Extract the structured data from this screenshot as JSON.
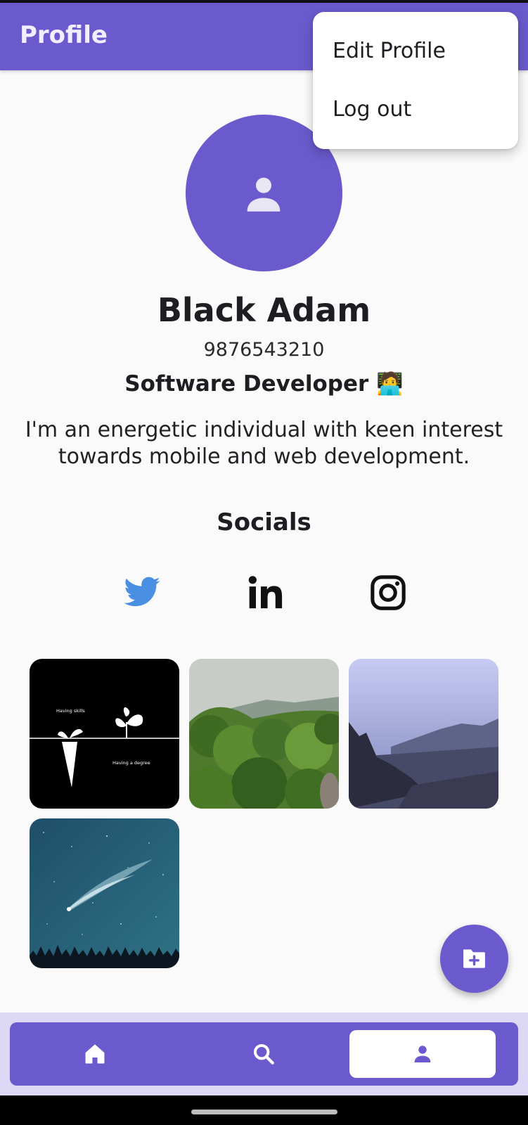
{
  "app_bar": {
    "title": "Profile"
  },
  "menu": {
    "edit_profile": "Edit Profile",
    "log_out": "Log out"
  },
  "profile": {
    "avatar_icon": "person-icon",
    "name": "Black Adam",
    "phone": "9876543210",
    "occupation": "Software Developer 🧑‍💻",
    "bio": "I'm an energetic individual with keen interest towards mobile and web development."
  },
  "socials": {
    "title": "Socials",
    "items": [
      {
        "icon": "twitter-icon",
        "color": "#4a90e2"
      },
      {
        "icon": "linkedin-icon",
        "color": "#111111"
      },
      {
        "icon": "instagram-icon",
        "color": "#111111"
      }
    ]
  },
  "photos": {
    "items": [
      {
        "id": "skills-vs-degree",
        "texts": [
          "Having skills",
          "Having a degree"
        ]
      },
      {
        "id": "forest-hills"
      },
      {
        "id": "misty-valley"
      },
      {
        "id": "comet-night-sky"
      }
    ]
  },
  "fab": {
    "icon": "add-folder-icon"
  },
  "bottom_nav": {
    "items": [
      {
        "icon": "home-icon",
        "active": false
      },
      {
        "icon": "search-icon",
        "active": false
      },
      {
        "icon": "profile-icon",
        "active": true
      }
    ]
  },
  "colors": {
    "primary": "#6a5acd",
    "nav_background": "#dcd8f5",
    "twitter": "#4a90e2"
  }
}
